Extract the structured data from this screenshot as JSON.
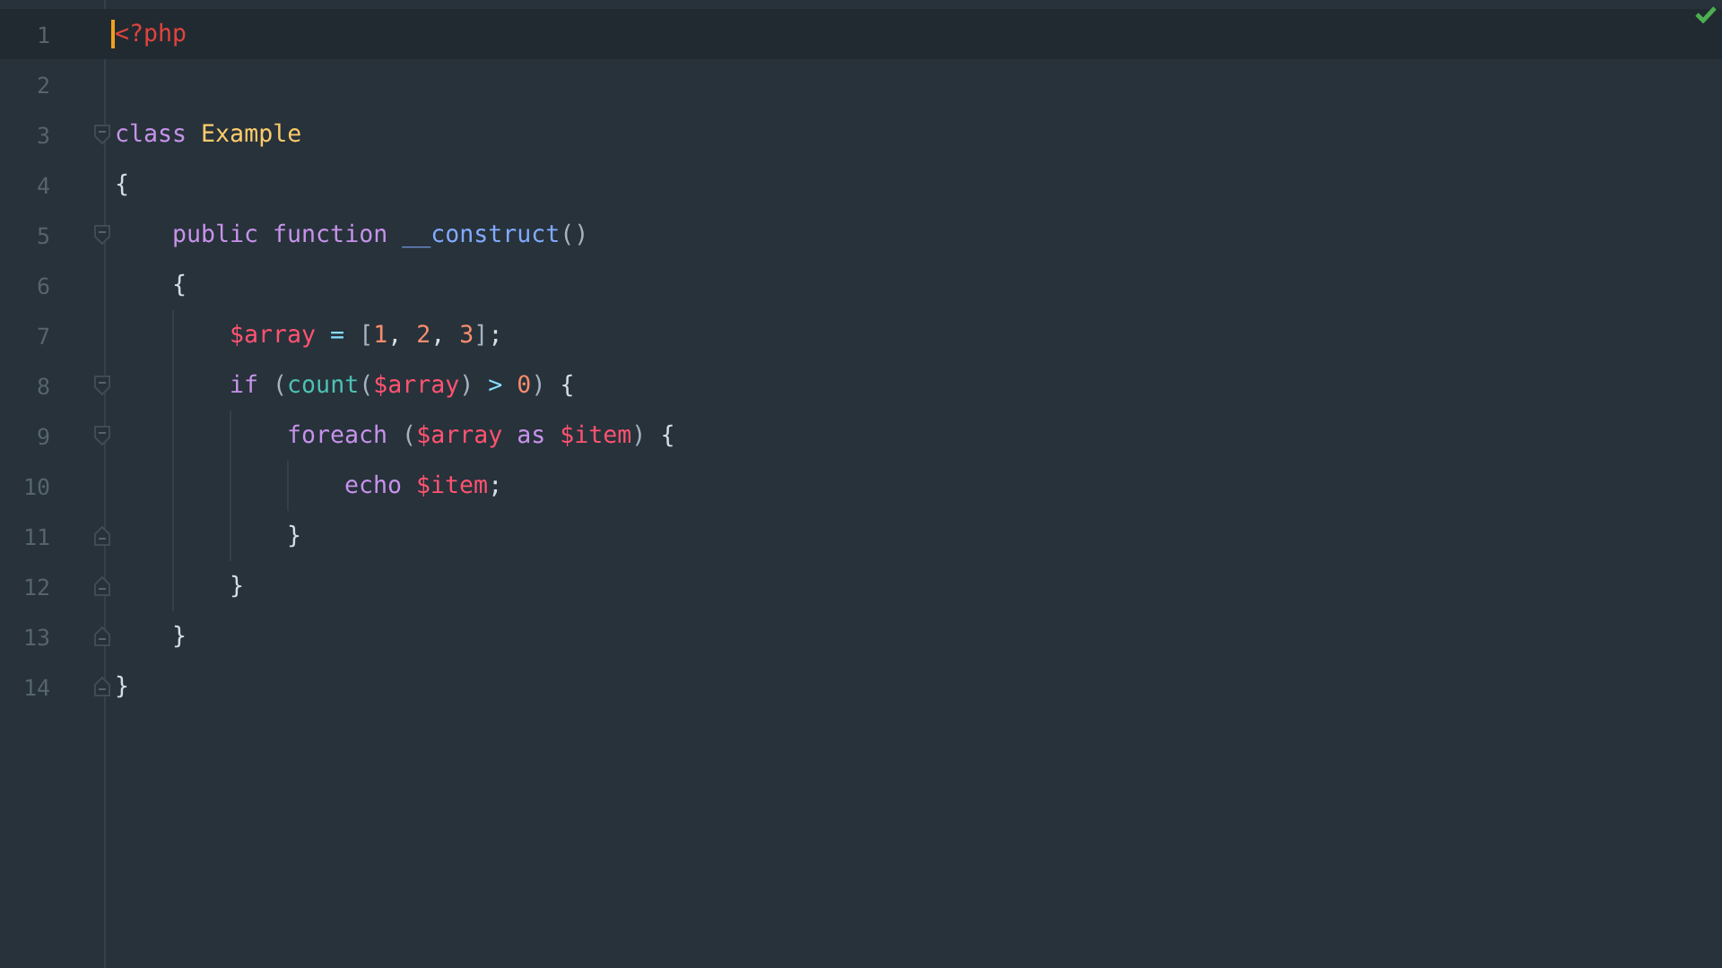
{
  "editor": {
    "lines": [
      {
        "number": "1",
        "current": true,
        "tokens": [
          {
            "text": "<?php",
            "kind": "tag"
          }
        ]
      },
      {
        "number": "2",
        "current": false
      },
      {
        "number": "3",
        "current": false,
        "fold_marker": {
          "kind": "open"
        },
        "tokens": [
          {
            "text": "class ",
            "kind": "keyword"
          },
          {
            "text": "Example",
            "kind": "class"
          }
        ]
      },
      {
        "number": "4",
        "current": false,
        "tokens": [
          {
            "text": "{",
            "kind": "plain"
          }
        ],
        "children": [
          {
            "number": "5",
            "current": false,
            "fold_marker": {
              "kind": "open"
            },
            "tokens": [
              {
                "text": "public function ",
                "kind": "keyword"
              },
              {
                "text": "__construct",
                "kind": "func"
              },
              {
                "text": "()",
                "kind": "punct"
              }
            ]
          },
          {
            "number": "6",
            "current": false,
            "tokens": [
              {
                "text": "{",
                "kind": "plain"
              }
            ],
            "children": [
              {
                "number": "7",
                "current": false,
                "tokens": [
                  {
                    "text": "$array",
                    "kind": "var"
                  },
                  {
                    "text": " = ",
                    "kind": "op"
                  },
                  {
                    "text": "[",
                    "kind": "punct"
                  },
                  {
                    "text": "1",
                    "kind": "num"
                  },
                  {
                    "text": ", ",
                    "kind": "plain"
                  },
                  {
                    "text": "2",
                    "kind": "num"
                  },
                  {
                    "text": ", ",
                    "kind": "plain"
                  },
                  {
                    "text": "3",
                    "kind": "num"
                  },
                  {
                    "text": "]",
                    "kind": "punct"
                  },
                  {
                    "text": ";",
                    "kind": "plain"
                  }
                ]
              },
              {
                "number": "8",
                "current": false,
                "fold_marker": {
                  "kind": "open"
                },
                "tokens": [
                  {
                    "text": "if ",
                    "kind": "keyword"
                  },
                  {
                    "text": "(",
                    "kind": "punct"
                  },
                  {
                    "text": "count",
                    "kind": "builtin"
                  },
                  {
                    "text": "(",
                    "kind": "punct"
                  },
                  {
                    "text": "$array",
                    "kind": "var"
                  },
                  {
                    "text": ") ",
                    "kind": "punct"
                  },
                  {
                    "text": "> ",
                    "kind": "op"
                  },
                  {
                    "text": "0",
                    "kind": "num"
                  },
                  {
                    "text": ") ",
                    "kind": "punct"
                  },
                  {
                    "text": "{",
                    "kind": "plain"
                  }
                ],
                "children": [
                  {
                    "number": "9",
                    "current": false,
                    "fold_marker": {
                      "kind": "open"
                    },
                    "tokens": [
                      {
                        "text": "foreach ",
                        "kind": "keyword"
                      },
                      {
                        "text": "(",
                        "kind": "punct"
                      },
                      {
                        "text": "$array",
                        "kind": "var"
                      },
                      {
                        "text": " as ",
                        "kind": "keyword"
                      },
                      {
                        "text": "$item",
                        "kind": "var"
                      },
                      {
                        "text": ") ",
                        "kind": "punct"
                      },
                      {
                        "text": "{",
                        "kind": "plain"
                      }
                    ],
                    "children": [
                      {
                        "number": "10",
                        "current": false,
                        "tokens": [
                          {
                            "text": "echo ",
                            "kind": "keyword"
                          },
                          {
                            "text": "$item",
                            "kind": "var"
                          },
                          {
                            "text": ";",
                            "kind": "plain"
                          }
                        ]
                      }
                    ]
                  },
                  {
                    "number": "11",
                    "current": false,
                    "fold_marker": {
                      "kind": "close"
                    },
                    "tokens": [
                      {
                        "text": "}",
                        "kind": "plain"
                      }
                    ]
                  }
                ]
              },
              {
                "number": "12",
                "current": false,
                "fold_marker": {
                  "kind": "close"
                },
                "tokens": [
                  {
                    "text": "}",
                    "kind": "plain"
                  }
                ]
              }
            ]
          },
          {
            "number": "13",
            "current": false,
            "fold_marker": {
              "kind": "close"
            },
            "tokens": [
              {
                "text": "}",
                "kind": "plain"
              }
            ]
          }
        ]
      },
      {
        "number": "14",
        "current": false,
        "fold_marker": {
          "kind": "close"
        },
        "tokens": [
          {
            "text": "}",
            "kind": "plain"
          }
        ]
      }
    ]
  }
}
